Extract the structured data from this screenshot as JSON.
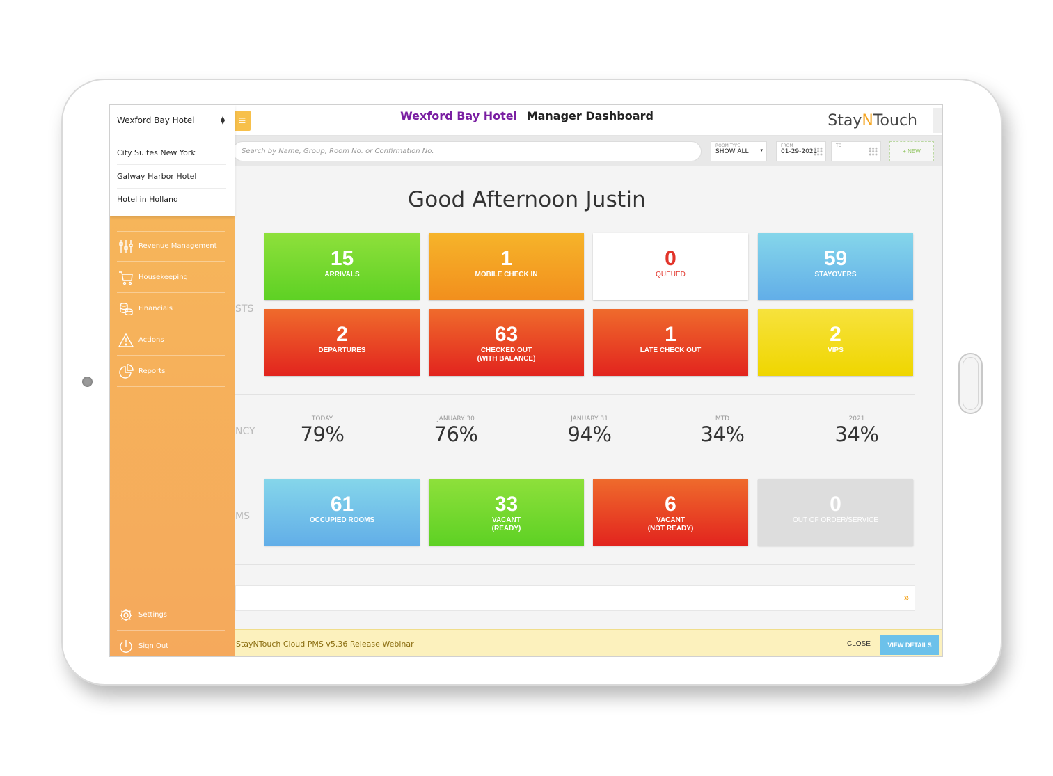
{
  "header": {
    "hotel_name": "Wexford Bay Hotel",
    "page_title": "Manager Dashboard",
    "brand": {
      "part1": "Stay",
      "part2": "N",
      "part3": "Touch"
    }
  },
  "search": {
    "placeholder": "Search by Name, Group, Room No. or Confirmation No.",
    "room_type_caption": "ROOM TYPE",
    "room_type_value": "SHOW ALL",
    "from_caption": "FROM",
    "from_value": "01-29-2021",
    "to_caption": "TO",
    "to_value": "",
    "new_label": "+ NEW"
  },
  "greeting": "Good Afternoon Justin",
  "sections": {
    "guests_label": "STS",
    "occupancy_label": "NCY",
    "rooms_label": "MS"
  },
  "guest_tiles": [
    {
      "value": "15",
      "label": "ARRIVALS"
    },
    {
      "value": "1",
      "label": "MOBILE CHECK IN"
    },
    {
      "value": "0",
      "label": "QUEUED"
    },
    {
      "value": "59",
      "label": "STAYOVERS"
    },
    {
      "value": "2",
      "label": "DEPARTURES"
    },
    {
      "value": "63",
      "label": "CHECKED OUT\n(WITH BALANCE)"
    },
    {
      "value": "1",
      "label": "LATE CHECK OUT"
    },
    {
      "value": "2",
      "label": "VIPS"
    }
  ],
  "occupancy": [
    {
      "caption": "TODAY",
      "value": "79%"
    },
    {
      "caption": "JANUARY 30",
      "value": "76%"
    },
    {
      "caption": "JANUARY 31",
      "value": "94%"
    },
    {
      "caption": "MTD",
      "value": "34%"
    },
    {
      "caption": "2021",
      "value": "34%"
    }
  ],
  "room_tiles": [
    {
      "value": "61",
      "label": "OCCUPIED ROOMS"
    },
    {
      "value": "33",
      "label": "VACANT\n(READY)"
    },
    {
      "value": "6",
      "label": "VACANT\n(NOT READY)"
    },
    {
      "value": "0",
      "label": "OUT OF ORDER/SERVICE"
    }
  ],
  "notification": {
    "text": "StayNTouch Cloud PMS v5.36 Release Webinar",
    "close_label": "CLOSE",
    "view_label": "VIEW DETAILS"
  },
  "hotel_dropdown": {
    "current": "Wexford Bay Hotel",
    "options": [
      "City Suites New York",
      "Galway Harbor Hotel",
      "Hotel in Holland"
    ]
  },
  "sidebar": {
    "items": [
      {
        "label": "Revenue Management",
        "icon": "sliders-icon"
      },
      {
        "label": "Housekeeping",
        "icon": "cart-icon"
      },
      {
        "label": "Financials",
        "icon": "coins-icon"
      },
      {
        "label": "Actions",
        "icon": "warning-icon"
      },
      {
        "label": "Reports",
        "icon": "pie-chart-icon"
      }
    ],
    "settings_label": "Settings",
    "signout_label": "Sign Out"
  },
  "colors": {
    "accent_orange": "#f5a623",
    "hotel_name_purple": "#7a1fa2",
    "arrivals_green": "#5ed124",
    "departures_red": "#e2241e",
    "stayovers_blue": "#62aee8",
    "vips_yellow": "#efd600"
  }
}
